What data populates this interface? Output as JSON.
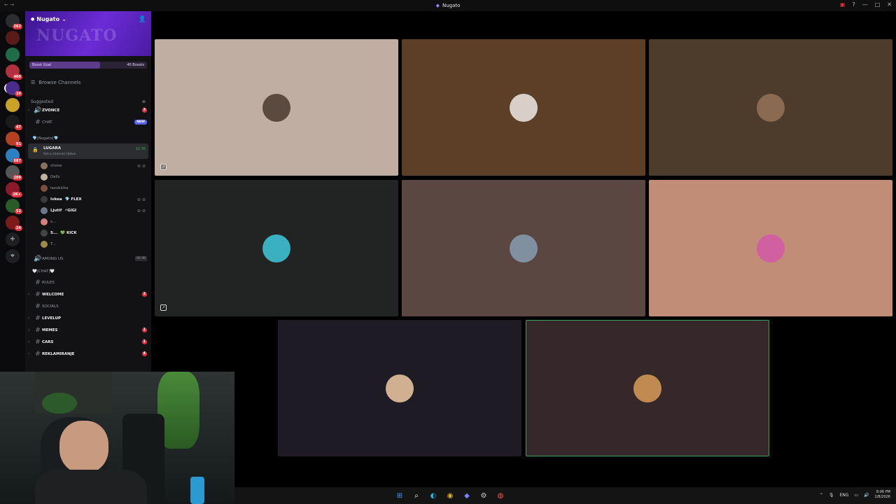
{
  "window": {
    "title": "Nugato"
  },
  "server": {
    "name": "Nugato",
    "banner_text": "NUGATO",
    "boost_label": "Boost Goal",
    "boost_count": "40 Boosts",
    "boost_progress": 0.6
  },
  "rail": [
    {
      "badge": "262",
      "color": "#2b2d31",
      "icon": "discord-home-icon"
    },
    {
      "badge": "",
      "color": "#5b1a1a"
    },
    {
      "badge": "",
      "color": "#1f6b4a"
    },
    {
      "badge": "460",
      "color": "#b03040"
    },
    {
      "badge": "10",
      "color": "#4a2c8a"
    },
    {
      "badge": "",
      "color": "#c9a227"
    },
    {
      "badge": "47",
      "color": "#1a1a1a"
    },
    {
      "badge": "91",
      "color": "#b34020"
    },
    {
      "badge": "687",
      "color": "#2a80c0"
    },
    {
      "badge": "209",
      "color": "#555"
    },
    {
      "badge": "2K+",
      "color": "#8a1a2a"
    },
    {
      "badge": "52",
      "color": "#2a5a2a"
    },
    {
      "badge": "24",
      "color": "#7a1a1a"
    }
  ],
  "sidebar": {
    "browse_label": "Browse Channels",
    "suggested_label": "Suggested",
    "suggested": [
      {
        "name": "ZVONCE",
        "badge": "3",
        "type": "voice"
      },
      {
        "name": "CHAT",
        "badge": "NEW",
        "type": "text"
      }
    ],
    "divider1": "💎|Nugato|💎",
    "active_voice": {
      "name": "LUGARA",
      "status": "Set a channel status",
      "time": "12:36"
    },
    "voice_users": [
      {
        "name": "chesa",
        "color": "#8a7060",
        "icons": ""
      },
      {
        "name": "Dellc",
        "color": "#c0b0a0",
        "icons": ""
      },
      {
        "name": "lazukićka",
        "color": "#7a5040",
        "icons": ""
      },
      {
        "name": "Ivkea",
        "tag": "💎 FLEX",
        "color": "#3a3a3a",
        "icons": ""
      },
      {
        "name": "Ljutif",
        "tag": "⚡GIGI",
        "color": "#6a7a8a",
        "icons": ""
      },
      {
        "name": "s...",
        "tag": "",
        "color": "#d08080",
        "icons": ""
      },
      {
        "name": "S...",
        "tag": "💚 KICK",
        "color": "#444",
        "icons": ""
      },
      {
        "name": "T...",
        "tag": "",
        "color": "#9a8a50",
        "icons": ""
      }
    ],
    "among_us": {
      "name": "AMONG US",
      "count": "00 99"
    },
    "divider2": "🤍|CHAT|🤍",
    "channels": [
      {
        "name": "RULES",
        "badge": "",
        "bold": false
      },
      {
        "name": "WELCOME",
        "badge": "2",
        "bold": true
      },
      {
        "name": "SOCIALS",
        "badge": "",
        "bold": false
      },
      {
        "name": "LEVELUP",
        "badge": "",
        "bold": true
      },
      {
        "name": "MEMES",
        "badge": "1",
        "bold": true
      },
      {
        "name": "CARS",
        "badge": "1",
        "bold": true
      },
      {
        "name": "REKLAMIRANJE",
        "badge": "4",
        "bold": true
      }
    ]
  },
  "tiles": [
    {
      "bg": "#c0aea2",
      "avatar": "#5a4a40",
      "has_icon": true
    },
    {
      "bg": "#5d3f28",
      "avatar": "#d8d0c8",
      "has_icon": false
    },
    {
      "bg": "#4d3c2c",
      "avatar": "#8a6a50",
      "has_icon": false
    },
    {
      "bg": "#222423",
      "avatar": "#3ab0c0",
      "has_icon": true
    },
    {
      "bg": "#5a4742",
      "avatar": "#8090a0",
      "has_icon": false
    },
    {
      "bg": "#c28d77",
      "avatar": "#d060a0",
      "has_icon": false
    },
    {
      "bg": "#1f1b24",
      "avatar": "#d0b090",
      "has_icon": false
    },
    {
      "bg": "#36272a",
      "avatar": "#c08a50",
      "has_icon": false,
      "speaking": true
    }
  ],
  "taskbar": {
    "lang": "ENG",
    "time": "8:06 PM",
    "date": "2/8/2026"
  }
}
